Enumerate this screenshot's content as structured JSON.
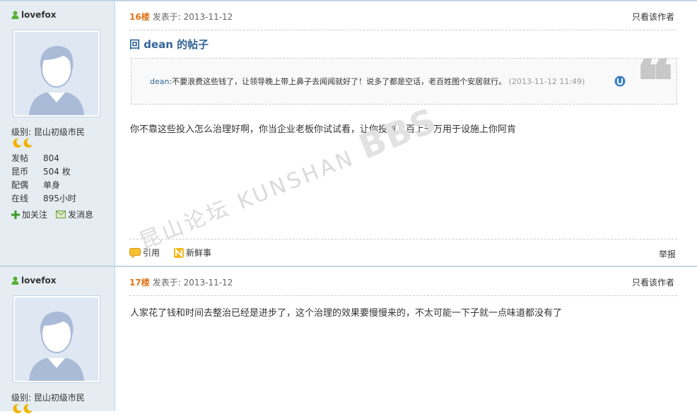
{
  "posts": [
    {
      "user": {
        "name": "lovefox",
        "level": "级别: 昆山初级市民",
        "stats": [
          {
            "key": "发帖",
            "value": "804"
          },
          {
            "key": "昆币",
            "value": "504 枚"
          },
          {
            "key": "配偶",
            "value": "单身"
          },
          {
            "key": "在线",
            "value": "895小时"
          }
        ],
        "follow_label": "加关注",
        "message_label": "发消息"
      },
      "floor": "16楼",
      "posted_label": "发表于:",
      "date": "2013-11-12",
      "only_author": "只看该作者",
      "title": "回 dean 的帖子",
      "quote": {
        "author": "dean",
        "text": ":不要浪费这些钱了，让领导晚上带上鼻子去闻闻就好了！说多了都是空话，老百姓图个安居就行。",
        "time": "(2013-11-12 11:49)"
      },
      "body": "你不靠这些投入怎么治理好啊，你当企业老板你试试看，让你投资几百上千万用于设施上你阿肯",
      "actions": {
        "quote": "引用",
        "share": "新鲜事",
        "report": "举报"
      }
    },
    {
      "user": {
        "name": "lovefox",
        "level": "级别: 昆山初级市民"
      },
      "floor": "17楼",
      "posted_label": "发表于:",
      "date": "2013-11-12",
      "only_author": "只看该作者",
      "body": "人家花了钱和时间去整治已经是进步了，这个治理的效果要慢慢来的，不太可能一下子就一点味道都没有了"
    }
  ],
  "watermark": {
    "cn": "昆山论坛",
    "en": "KUNSHAN",
    "bbs": "BBS"
  },
  "colors": {
    "sidebar": "#e5edf2",
    "floor": "#e0751a",
    "link": "#336699"
  }
}
